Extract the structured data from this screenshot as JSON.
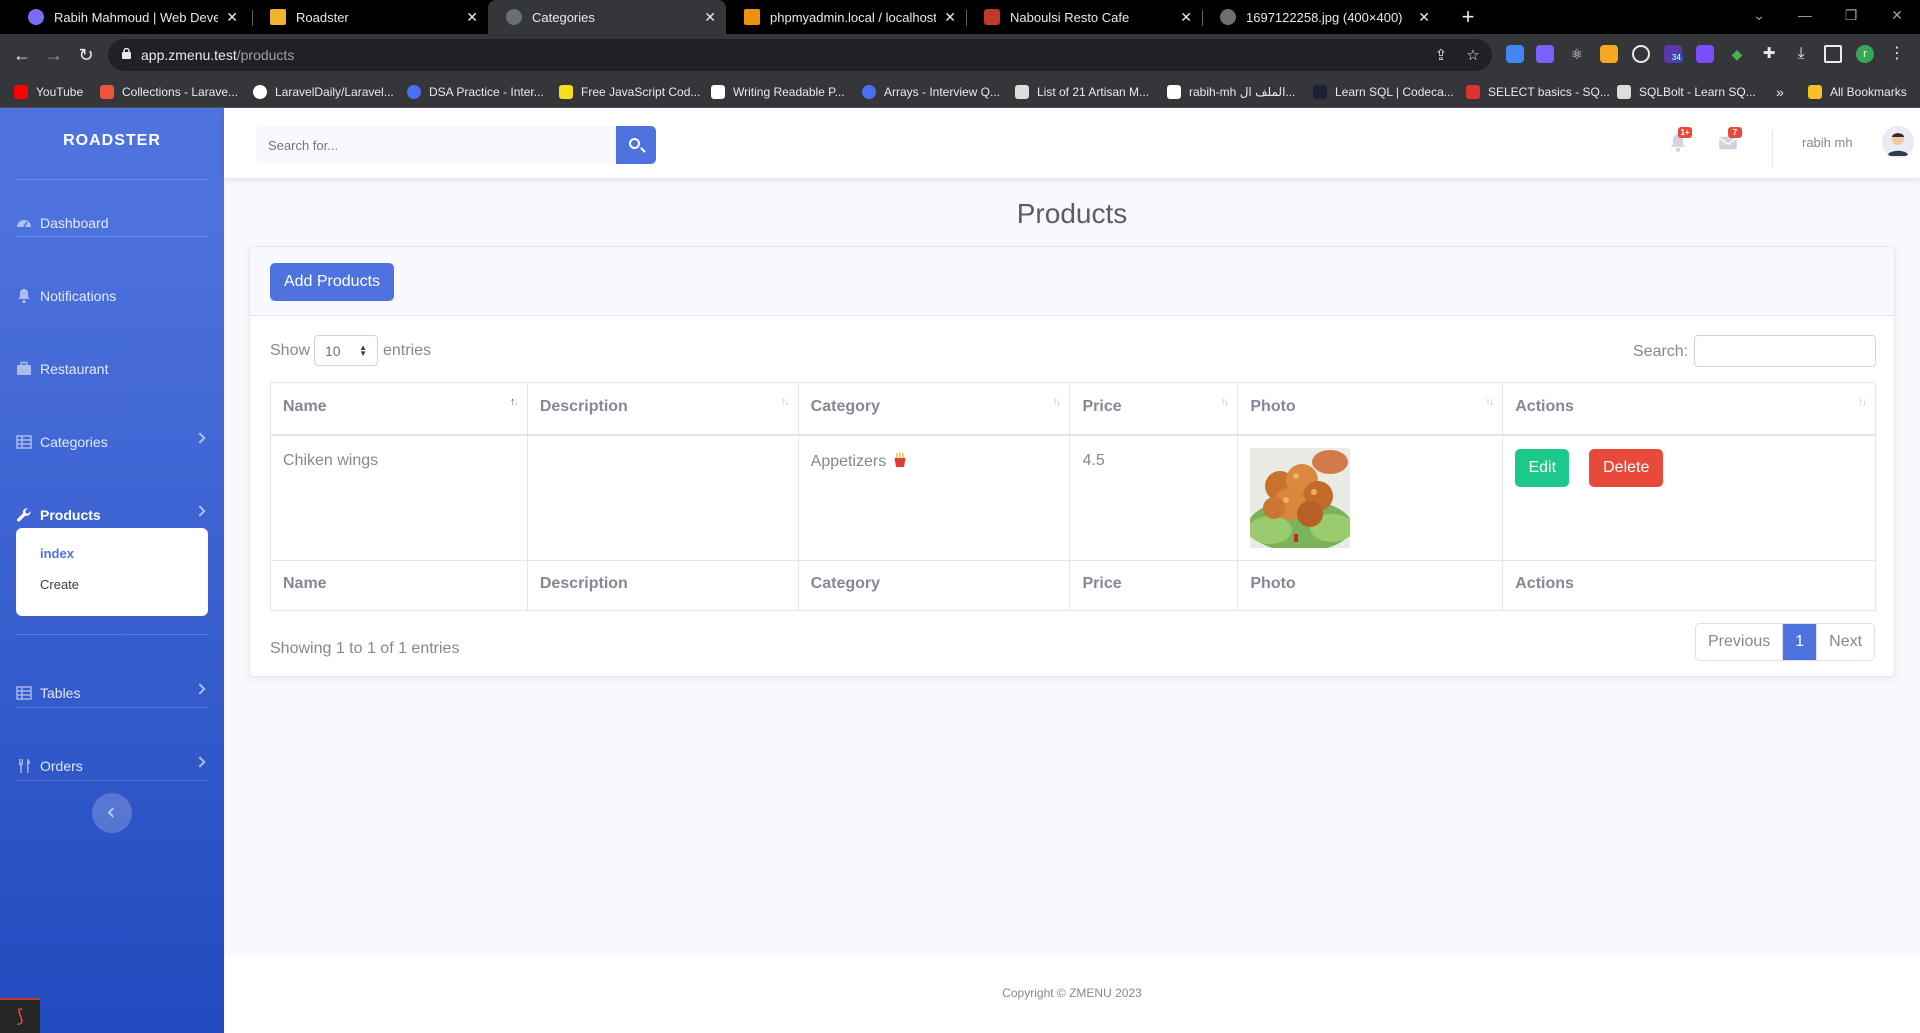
{
  "browser": {
    "tabs": [
      {
        "label": "Rabih Mahmoud | Web Develop",
        "icon": "portfolio-favicon",
        "color": "#7b6cf6"
      },
      {
        "label": "Roadster",
        "icon": "roadster-favicon",
        "color": "#f0b429"
      },
      {
        "label": "Categories",
        "icon": "globe-favicon",
        "color": "#9aa0a6",
        "active": true
      },
      {
        "label": "phpmyadmin.local / localhost / ",
        "icon": "phpmyadmin-favicon",
        "color": "#f29111"
      },
      {
        "label": "Naboulsi Resto Cafe",
        "icon": "resto-favicon",
        "color": "#c0392b"
      },
      {
        "label": "1697122258.jpg (400×400)",
        "icon": "globe-favicon",
        "color": "#9aa0a6"
      }
    ],
    "address": {
      "host": "app.zmenu.test",
      "path": "/products"
    },
    "profile_initial": "r",
    "extension_badge": "34",
    "bookmarks": [
      {
        "label": "YouTube",
        "color": "#ff0000"
      },
      {
        "label": "Collections - Larave...",
        "color": "#f05340"
      },
      {
        "label": "LaravelDaily/Laravel...",
        "color": "#ffffff"
      },
      {
        "label": "DSA Practice - Inter...",
        "color": "#4c6ef5"
      },
      {
        "label": "Free JavaScript Cod...",
        "color": "#f7df1e"
      },
      {
        "label": "Writing Readable P...",
        "color": "#ffffff"
      },
      {
        "label": "Arrays - Interview Q...",
        "color": "#4c6ef5"
      },
      {
        "label": "List of 21 Artisan M...",
        "color": "#dddddd"
      },
      {
        "label": "rabih-mh الملف ال...",
        "color": "#ffffff"
      },
      {
        "label": "Learn SQL | Codeca...",
        "color": "#1f1f3a"
      },
      {
        "label": "SELECT basics - SQ...",
        "color": "#e03131"
      },
      {
        "label": "SQLBolt - Learn SQ...",
        "color": "#dddddd"
      }
    ],
    "overflow_label": "»",
    "all_bookmarks": "All Bookmarks"
  },
  "sidebar": {
    "brand": "ROADSTER",
    "items": [
      {
        "label": "Dashboard",
        "icon": "dashboard-icon"
      },
      {
        "label": "Notifications",
        "icon": "bell-icon"
      },
      {
        "label": "Restaurant",
        "icon": "briefcase-icon"
      },
      {
        "label": "Categories",
        "icon": "table-icon"
      },
      {
        "label": "Products",
        "icon": "wrench-icon"
      },
      {
        "label": "Tables",
        "icon": "table-icon"
      },
      {
        "label": "Orders",
        "icon": "utensils-icon"
      }
    ],
    "submenu": [
      "index",
      "Create"
    ]
  },
  "topbar": {
    "search_placeholder": "Search for...",
    "alerts_badge": "1+",
    "messages_badge": "7",
    "username": "rabih mh"
  },
  "page": {
    "title": "Products",
    "add_button": "Add Products",
    "show_label": "Show",
    "page_length": "10",
    "entries_label": "entries",
    "search_label": "Search:",
    "columns": [
      "Name",
      "Description",
      "Category",
      "Price",
      "Photo",
      "Actions"
    ],
    "rows": [
      {
        "name": "Chiken wings",
        "description": "",
        "category": "Appetizers",
        "price": "4.5",
        "photo": "fried chicken wings on lettuce",
        "edit": "Edit",
        "delete": "Delete"
      }
    ],
    "info": "Showing 1 to 1 of 1 entries",
    "pagination": {
      "previous": "Previous",
      "current": "1",
      "next": "Next"
    }
  },
  "footer": {
    "copyright": "Copyright © ZMENU 2023"
  },
  "colors": {
    "primary": "#4e73df",
    "success": "#1cc88a",
    "danger": "#e74a3b",
    "text_muted": "#858796"
  }
}
